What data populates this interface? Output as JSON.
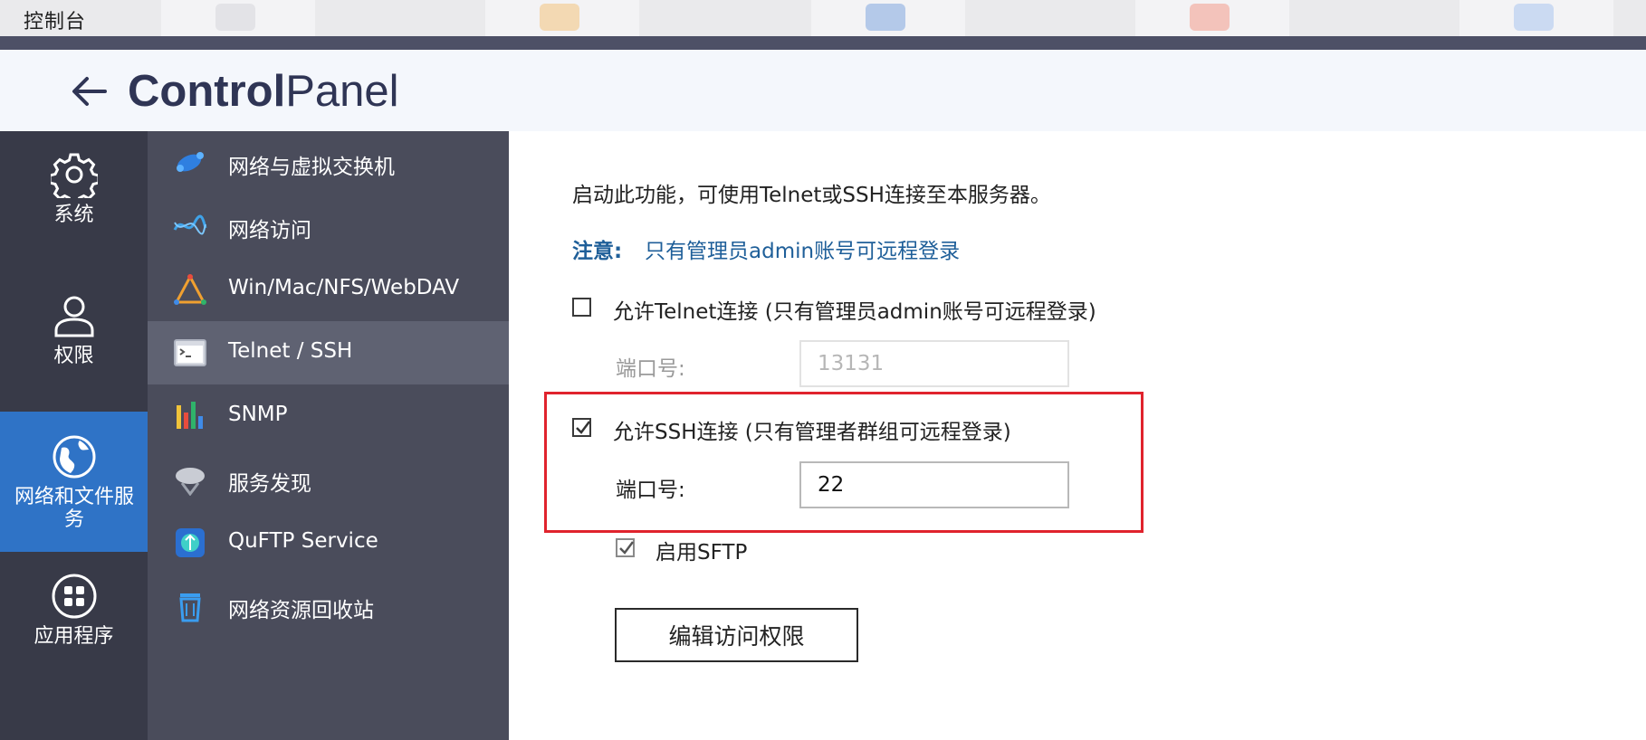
{
  "topbar": {
    "title": "控制台"
  },
  "header": {
    "title_bold": "Control",
    "title_light": "Panel",
    "back_icon": "arrow-left-icon"
  },
  "rail": {
    "items": [
      {
        "label": "系统",
        "icon": "gear-icon",
        "active": false
      },
      {
        "label": "权限",
        "icon": "user-icon",
        "active": false
      },
      {
        "label": "网络和文件服务",
        "icon": "globe-icon",
        "active": true
      },
      {
        "label": "应用程序",
        "icon": "apps-grid-icon",
        "active": false
      }
    ]
  },
  "submenu": {
    "items": [
      {
        "label": "网络与虚拟交换机",
        "icon": "network-switch-icon"
      },
      {
        "label": "网络访问",
        "icon": "network-access-icon"
      },
      {
        "label": "Win/Mac/NFS/WebDAV",
        "icon": "file-protocols-icon"
      },
      {
        "label": "Telnet / SSH",
        "icon": "terminal-icon",
        "active": true
      },
      {
        "label": "SNMP",
        "icon": "bar-chart-icon"
      },
      {
        "label": "服务发现",
        "icon": "satellite-dish-icon"
      },
      {
        "label": "QuFTP Service",
        "icon": "ftp-icon"
      },
      {
        "label": "网络资源回收站",
        "icon": "recycle-bin-icon"
      }
    ]
  },
  "content": {
    "description": "启动此功能，可使用Telnet或SSH连接至本服务器。",
    "note_label": "注意:",
    "note_text": "只有管理员admin账号可远程登录",
    "telnet": {
      "label": "允许Telnet连接 (只有管理员admin账号可远程登录)",
      "checked": false,
      "port_label": "端口号:",
      "port_value": "13131"
    },
    "ssh": {
      "label": "允许SSH连接 (只有管理者群组可远程登录)",
      "checked": true,
      "port_label": "端口号:",
      "port_value": "22"
    },
    "sftp": {
      "label": "启用SFTP",
      "checked": true
    },
    "edit_button": "编辑访问权限"
  },
  "colors": {
    "rail_bg": "#383a48",
    "submenu_bg": "#4a4c5b",
    "active_rail": "#2f73c6",
    "note": "#1f5f99",
    "highlight": "#e0232d"
  }
}
